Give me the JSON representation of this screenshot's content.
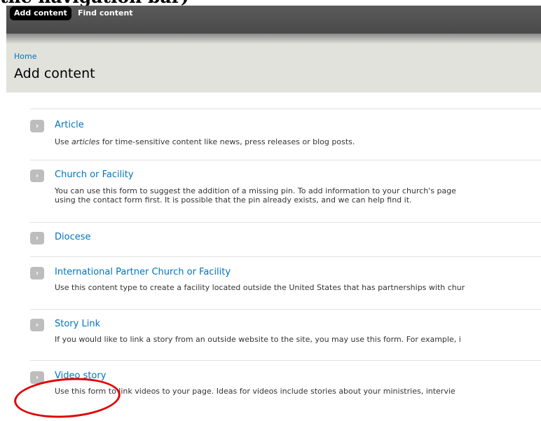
{
  "caption": "the navigation bar)",
  "toolbar": {
    "add_content": "Add content",
    "find_content": "Find content"
  },
  "breadcrumb": "Home",
  "page_title": "Add content",
  "items": [
    {
      "title": "Article",
      "desc_prefix": "Use ",
      "desc_em": "articles",
      "desc_suffix": " for time-sensitive content like news, press releases or blog posts."
    },
    {
      "title": "Church or Facility",
      "desc1": "You can use this form to suggest the addition of a missing pin. To add information to your church's page",
      "desc2": "using the contact form first. It is possible that the pin already exists, and we can help find it."
    },
    {
      "title": "Diocese"
    },
    {
      "title": "International Partner Church or Facility",
      "desc1": "Use this content type to create a facility located outside the United States that has partnerships with chur"
    },
    {
      "title": "Story Link",
      "desc1": "If you would like to link a story from an outside website to the site, you may use this form. For example, i"
    },
    {
      "title": "Video story",
      "desc1": "Use this form to link videos to your page. Ideas for videos include stories about your ministries, intervie"
    }
  ],
  "icons": {
    "item_arrow": "chevron-right-icon",
    "highlight_color": "#e00000",
    "link_color": "#0074bd"
  }
}
